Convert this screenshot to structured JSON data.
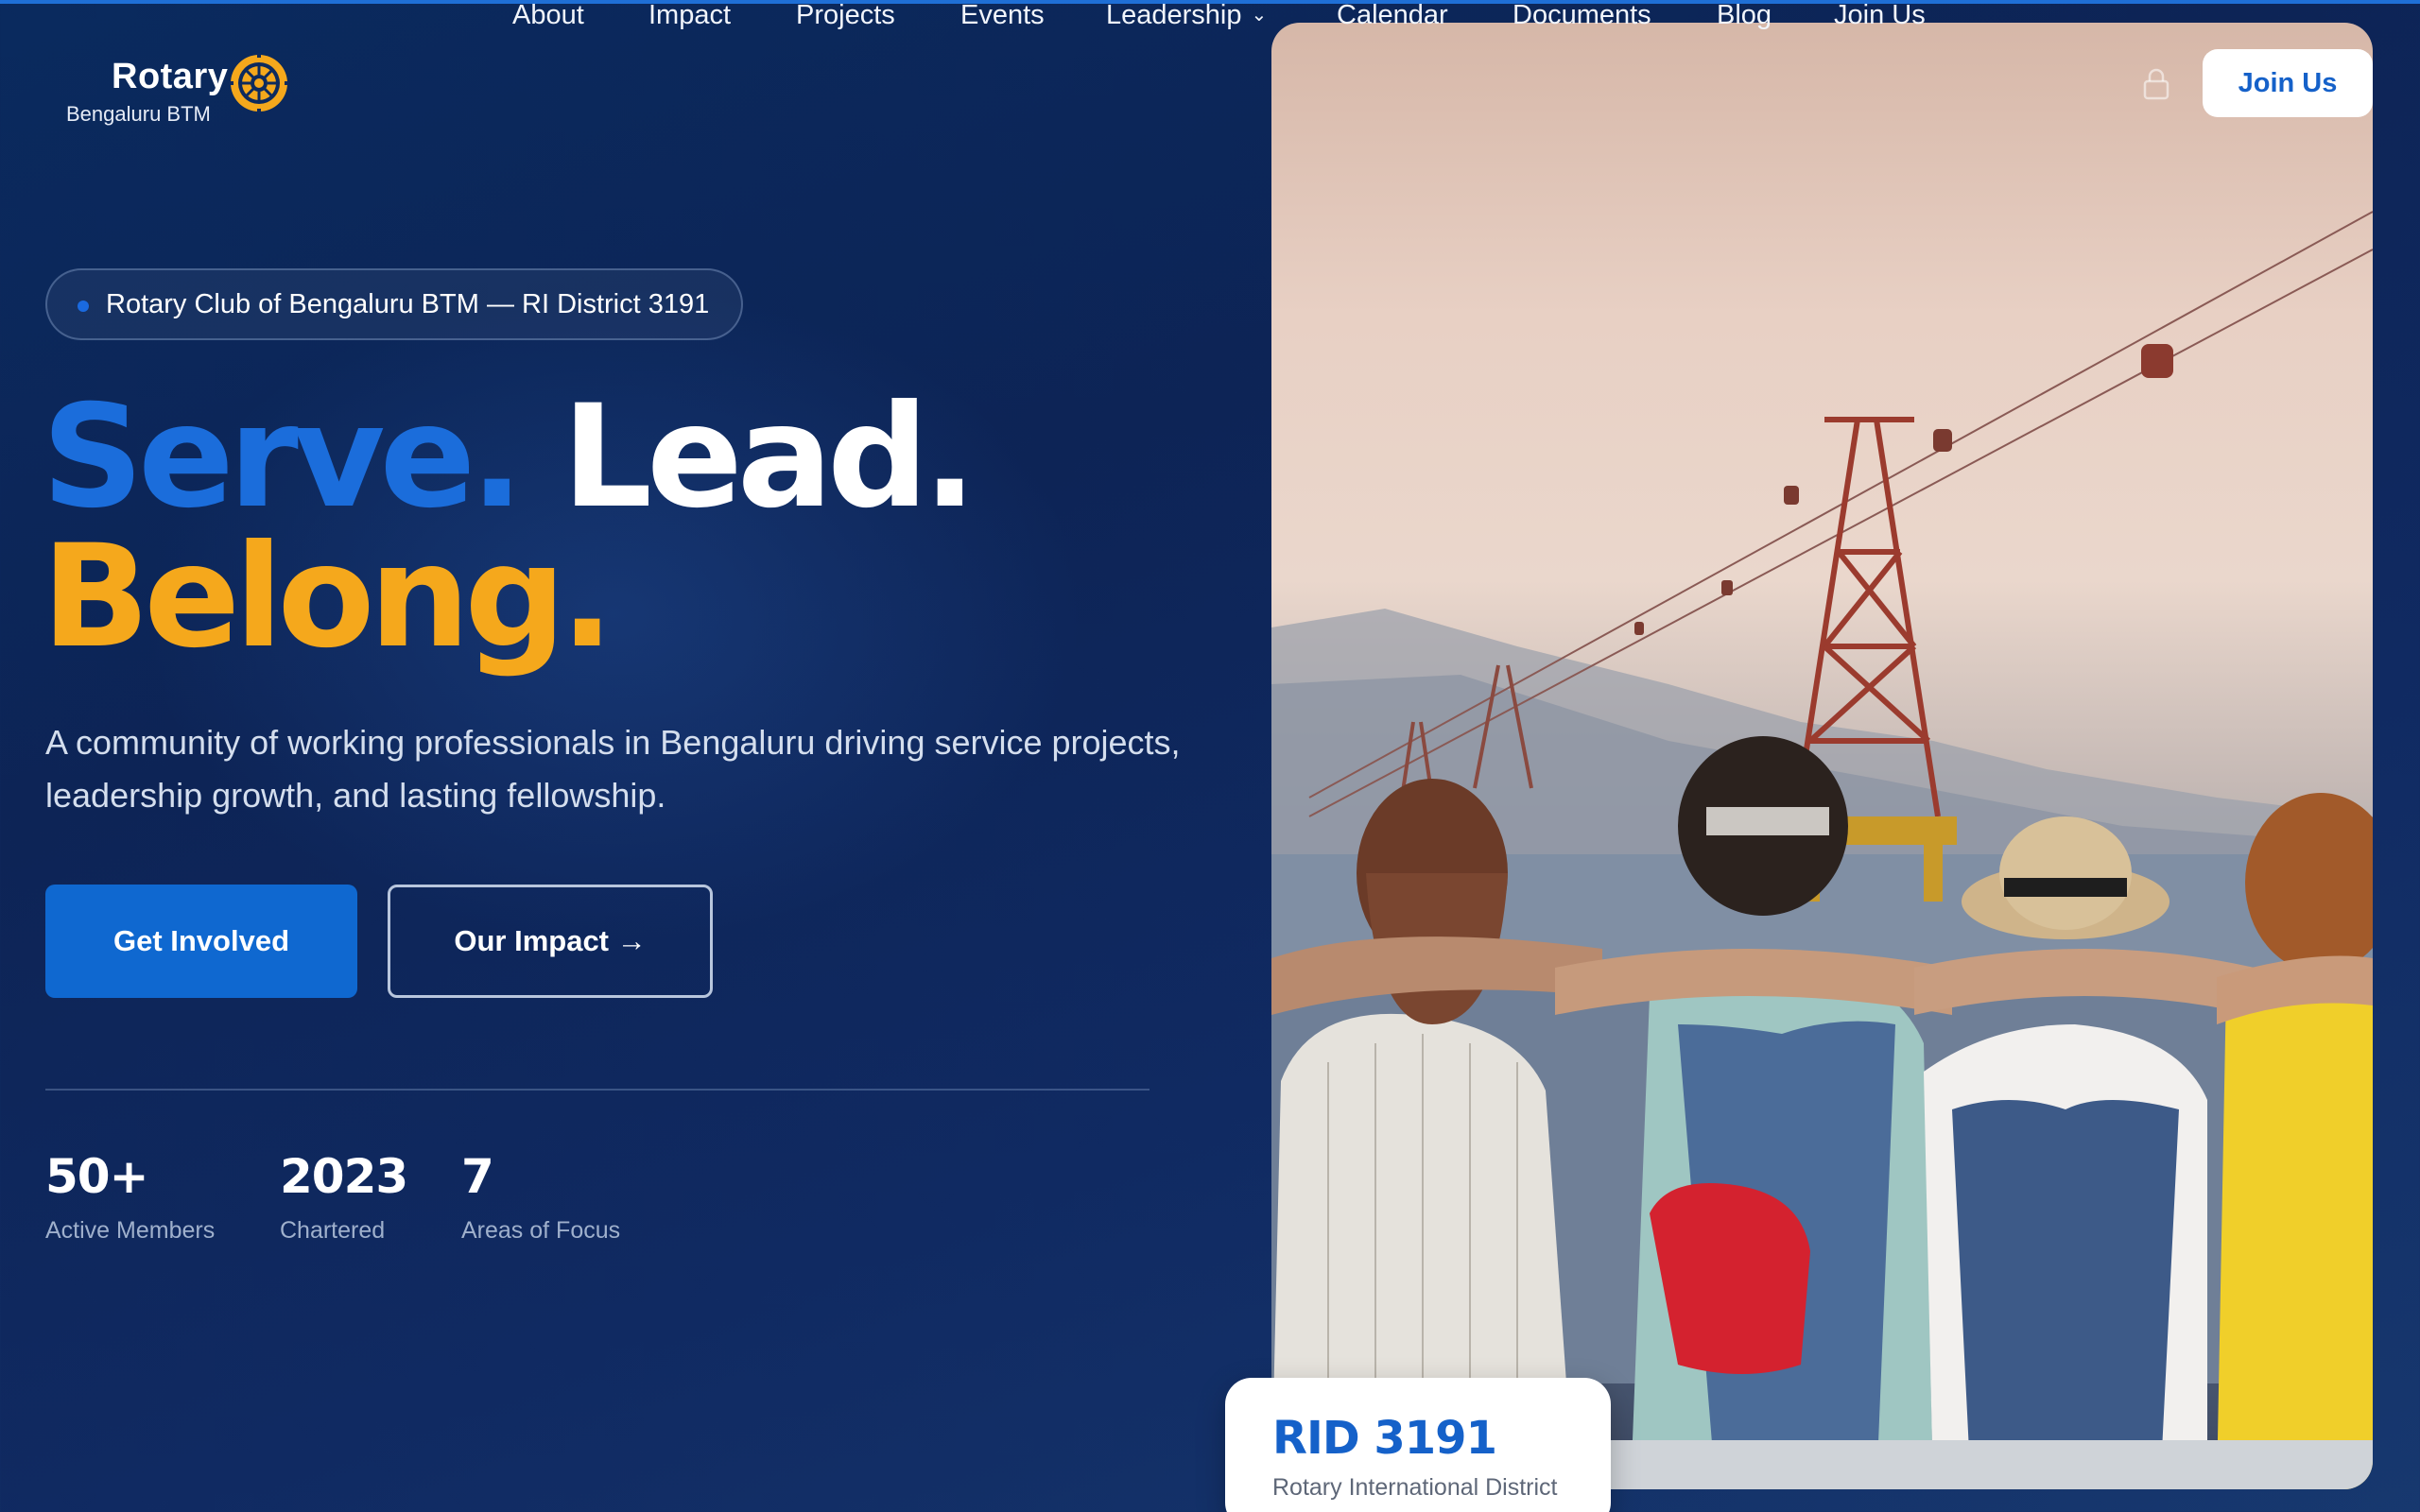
{
  "brand": {
    "name": "Rotary",
    "subtitle": "Bengaluru BTM"
  },
  "nav": {
    "items": [
      {
        "label": "About"
      },
      {
        "label": "Impact"
      },
      {
        "label": "Projects"
      },
      {
        "label": "Events"
      },
      {
        "label": "Leadership",
        "has_dropdown": true
      },
      {
        "label": "Calendar"
      },
      {
        "label": "Documents"
      },
      {
        "label": "Blog"
      },
      {
        "label": "Join Us"
      }
    ],
    "login_icon": "lock-icon",
    "cta_label": "Join Us"
  },
  "hero": {
    "badge": "Rotary Club of Bengaluru BTM — RI District 3191",
    "headline": {
      "word1": "Serve.",
      "word2": "Lead.",
      "word3": "Belong."
    },
    "description": "A community of working professionals in Bengaluru driving service projects, leadership growth, and lasting fellowship.",
    "primary_button": "Get Involved",
    "secondary_button": "Our Impact →",
    "stats": [
      {
        "value": "50+",
        "label": "Active Members"
      },
      {
        "value": "2023",
        "label": "Chartered"
      },
      {
        "value": "7",
        "label": "Areas of Focus"
      }
    ]
  },
  "district_card": {
    "title": "RID 3191",
    "subtitle": "Rotary International District"
  },
  "colors": {
    "accent_blue": "#1b6ddb",
    "accent_gold": "#f5a81c",
    "background_navy": "#0d2456",
    "white": "#ffffff"
  }
}
